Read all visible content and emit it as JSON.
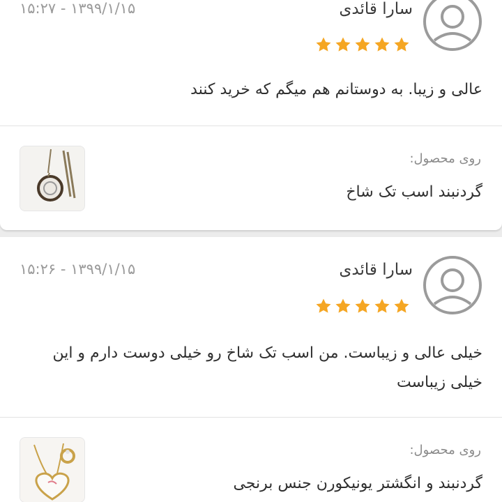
{
  "reviews": [
    {
      "author": "سارا قائدی",
      "timestamp": "۱۵:۲۷ - ۱۳۹۹/۱/۱۵",
      "rating": 5,
      "comment": "عالی و زیبا. به دوستانم هم میگم که خرید کنند",
      "product_caption": "روی محصول:",
      "product_name": "گردنبند اسب تک شاخ"
    },
    {
      "author": "سارا قائدی",
      "timestamp": "۱۵:۲۶ - ۱۳۹۹/۱/۱۵",
      "rating": 5,
      "comment": "خیلی عالی و زیباست. من اسب تک شاخ رو خیلی دوست دارم و این خیلی زیباست",
      "product_caption": "روی محصول:",
      "product_name": "گردنبند و انگشتر یونیکورن جنس برنجی"
    }
  ],
  "colors": {
    "star": "#f5a623",
    "avatar_stroke": "#9b9b9b"
  },
  "icons": {
    "avatar": "user-avatar-icon",
    "star": "star-icon"
  }
}
